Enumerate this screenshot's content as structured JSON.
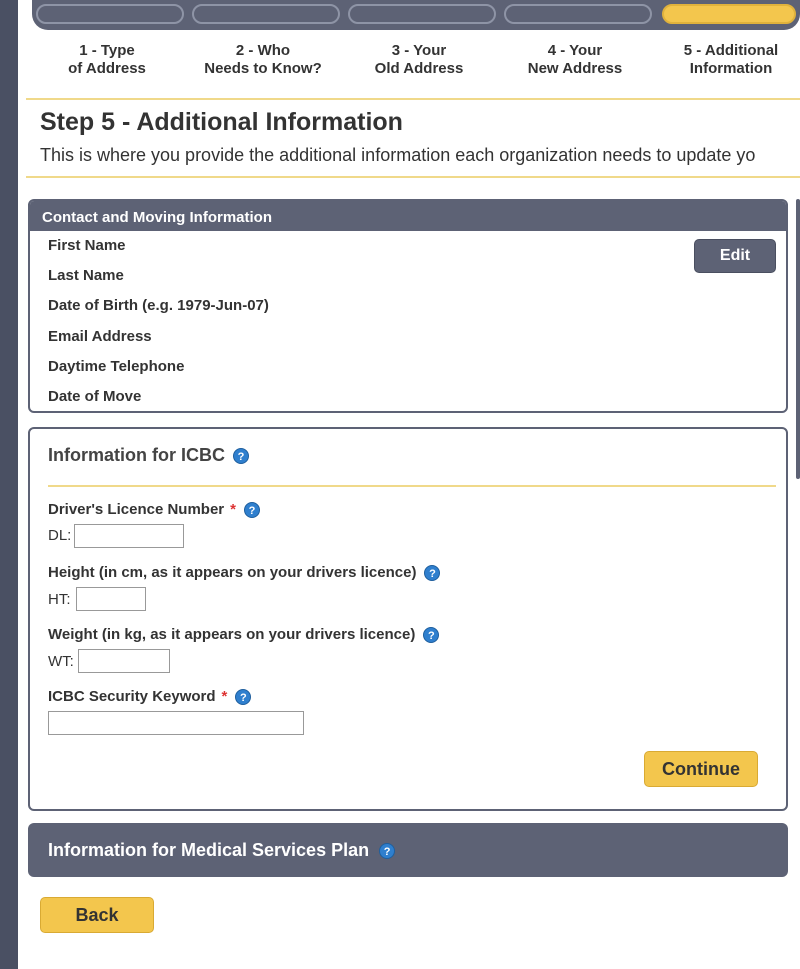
{
  "progress": {
    "steps": [
      {
        "line1": "1 - Type",
        "line2": "of Address"
      },
      {
        "line1": "2 - Who",
        "line2": "Needs to Know?"
      },
      {
        "line1": "3 - Your",
        "line2": "Old Address"
      },
      {
        "line1": "4 - Your",
        "line2": "New Address"
      },
      {
        "line1": "5 - Additional",
        "line2": "Information"
      }
    ],
    "active_step": 5
  },
  "header": {
    "title": "Step 5 - Additional Information",
    "intro": "This is where you provide the additional information each organization needs to update yo"
  },
  "contact": {
    "heading": "Contact and Moving Information",
    "fields": [
      "First Name",
      "Last Name",
      "Date of Birth (e.g. 1979-Jun-07)",
      "Email Address",
      "Daytime Telephone",
      "Date of Move"
    ],
    "edit_label": "Edit"
  },
  "icbc": {
    "title": "Information for ICBC",
    "help_glyph": "?",
    "dl_label": "Driver's Licence Number",
    "dl_prefix": "DL:",
    "height_label": "Height (in cm, as it appears on your drivers licence)",
    "height_prefix": "HT:",
    "weight_label": "Weight (in kg, as it appears on your drivers licence)",
    "weight_prefix": "WT:",
    "keyword_label": "ICBC Security Keyword",
    "required_mark": "*",
    "continue_label": "Continue"
  },
  "msp": {
    "title": "Information for Medical Services Plan"
  },
  "back_label": "Back",
  "colors": {
    "panel": "#5d6275",
    "accent": "#f3c64d",
    "help": "#2f7fce",
    "required": "#dd3333"
  }
}
